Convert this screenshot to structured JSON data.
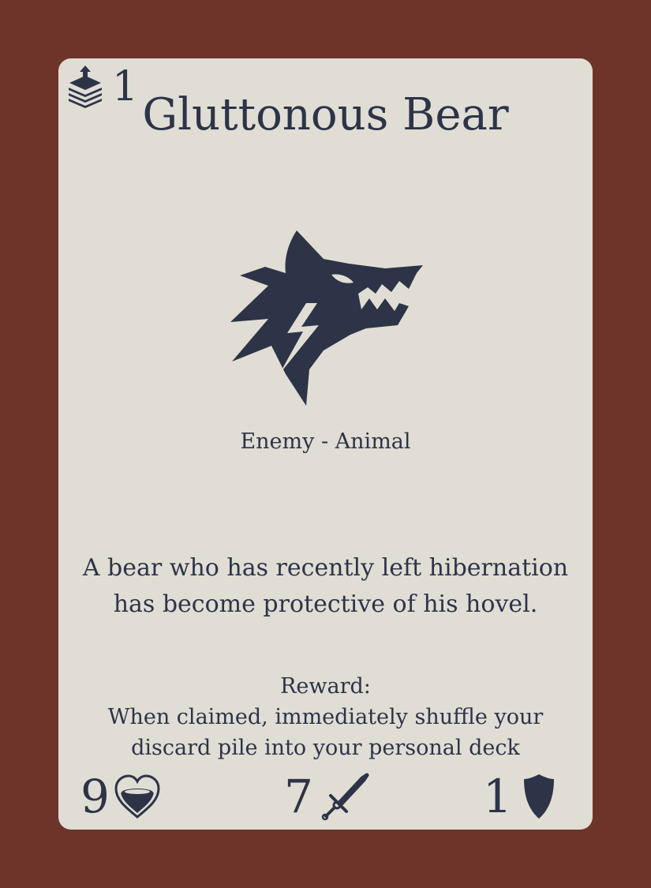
{
  "card": {
    "cost": "1",
    "title": "Gluttonous Bear",
    "type_line": "Enemy - Animal",
    "flavor_lines": [
      "A bear who has recently left hibernation",
      "has become protective of his hovel."
    ],
    "reward_heading": "Reward:",
    "reward_lines": [
      "When claimed, immediately shuffle your",
      "discard pile into your personal deck"
    ],
    "stats": {
      "health": "9",
      "attack": "7",
      "defense": "1"
    },
    "icons": {
      "cost": "card-stack-up-arrow-icon",
      "art": "snarling-beast-head-icon",
      "health": "heart-icon",
      "attack": "sword-icon",
      "defense": "shield-icon"
    }
  },
  "colors": {
    "background": "#6e342a",
    "card": "#e0ddd5",
    "ink": "#2d3447"
  }
}
